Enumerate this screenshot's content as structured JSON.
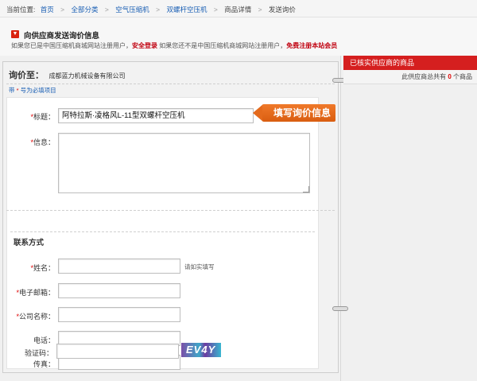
{
  "breadcrumb": {
    "prefix": "当前位置:",
    "items": [
      "首页",
      "全部分类",
      "空气压缩机",
      "双螺杆空压机"
    ],
    "current": [
      "商品详情",
      "发送询价"
    ]
  },
  "notice": {
    "title": "向供应商发送询价信息",
    "desc_1": "如果您已是中国压缩机商城网站注册用户，",
    "login_link": "安全登录",
    "desc_2": " 如果您还不是中国压缩机商城网站注册用户，",
    "register_link": "免费注册本站会员"
  },
  "inquiry": {
    "label": "询价至：",
    "company": "成都蓝力机械设备有限公司",
    "required_note_prefix": "带",
    "required_note_star": "*",
    "required_note_suffix": "号为必填项目"
  },
  "form": {
    "title_label": "标题：",
    "title_value": "阿特拉斯·凌格风L-11型双螺杆空压机",
    "message_label": "信息：",
    "message_value": "",
    "contact_section": "联系方式",
    "name_label": "姓名：",
    "name_hint": "请如实填写",
    "email_label": "电子邮箱：",
    "company_label": "公司名称：",
    "phone_label": "电话：",
    "fax_label": "传真：",
    "captcha_label": "验证码：",
    "captcha_text": "EV4Y",
    "star": "*"
  },
  "callout": {
    "text": "填写询价信息",
    "color": "#e8701f"
  },
  "sidebar": {
    "header": "已核实供应商的商品",
    "count_prefix": "此供应商总共有",
    "count": "0",
    "count_suffix": "个商品"
  },
  "colors": {
    "accent_red": "#d51f1f",
    "link_blue": "#1a5fb4",
    "callout_orange": "#e8701f"
  }
}
